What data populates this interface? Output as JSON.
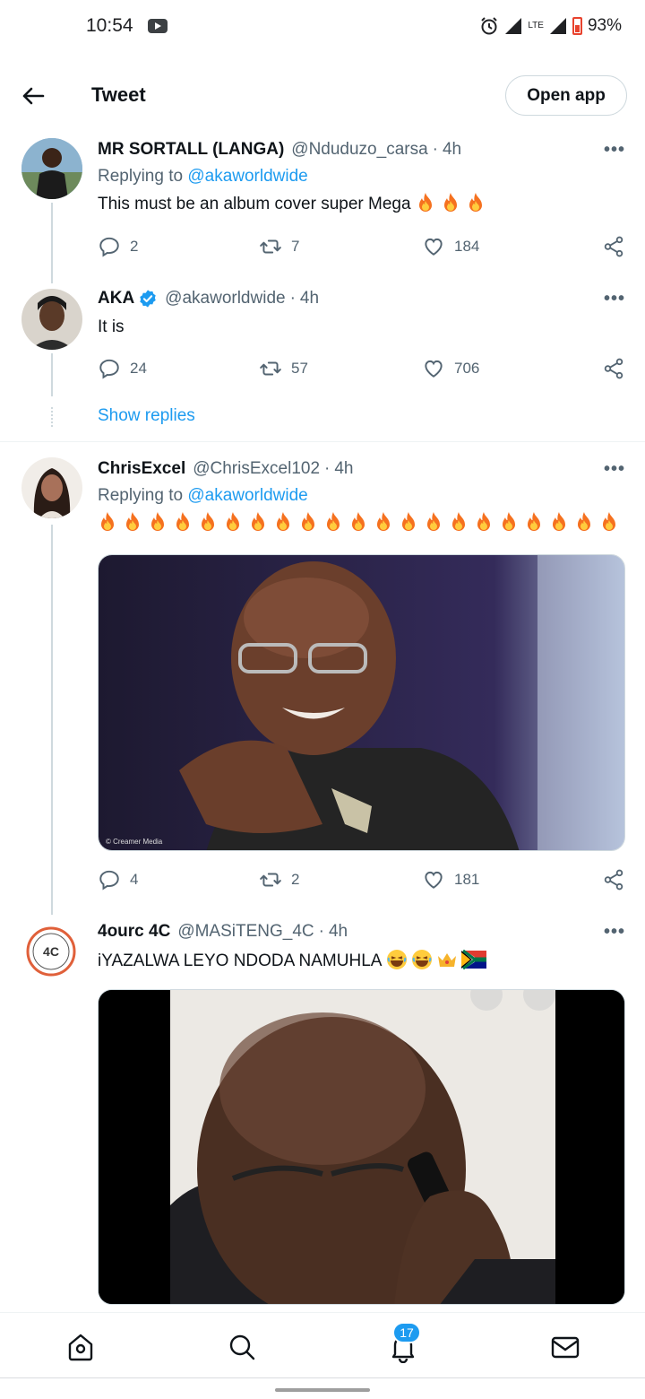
{
  "status_bar": {
    "time": "10:54",
    "network": "LTE",
    "battery": "93%"
  },
  "header": {
    "title": "Tweet",
    "open_app_label": "Open app"
  },
  "tweets": [
    {
      "name": "MR SORTALL (LANGA)",
      "handle": "@Nduduzo_carsa",
      "time": "4h",
      "replying_prefix": "Replying to",
      "replying_to": "@akaworldwide",
      "text": "This must be an album cover super Mega",
      "emoji": "🔥🔥🔥",
      "replies": "2",
      "retweets": "7",
      "likes": "184"
    },
    {
      "name": "AKA",
      "verified": true,
      "handle": "@akaworldwide",
      "time": "4h",
      "text": "It is",
      "replies": "24",
      "retweets": "57",
      "likes": "706",
      "show_replies_label": "Show replies"
    },
    {
      "name": "ChrisExcel",
      "handle": "@ChrisExcel102",
      "time": "4h",
      "replying_prefix": "Replying to",
      "replying_to": "@akaworldwide",
      "emoji": "🔥🔥🔥🔥🔥🔥🔥🔥🔥🔥🔥🔥🔥🔥🔥🔥🔥🔥🔥🔥🔥",
      "image_credit": "© Creamer Media",
      "replies": "4",
      "retweets": "2",
      "likes": "181"
    },
    {
      "name": "4ourc 4C",
      "handle": "@MASiTENG_4C",
      "time": "4h",
      "text": "iYAZALWA LEYO NDODA NAMUHLA",
      "emoji": "😂😂👑🇿🇦",
      "avatar_text": "4C"
    }
  ],
  "bottom_nav": {
    "notifications_badge": "17"
  },
  "colors": {
    "accent": "#1d9bf0",
    "secondary_text": "#536471",
    "like": "#536471"
  },
  "icons": [
    "back-arrow-icon",
    "reply-icon",
    "retweet-icon",
    "heart-icon",
    "share-icon",
    "more-icon",
    "verified-icon",
    "home-icon",
    "search-icon",
    "bell-icon",
    "mail-icon"
  ]
}
